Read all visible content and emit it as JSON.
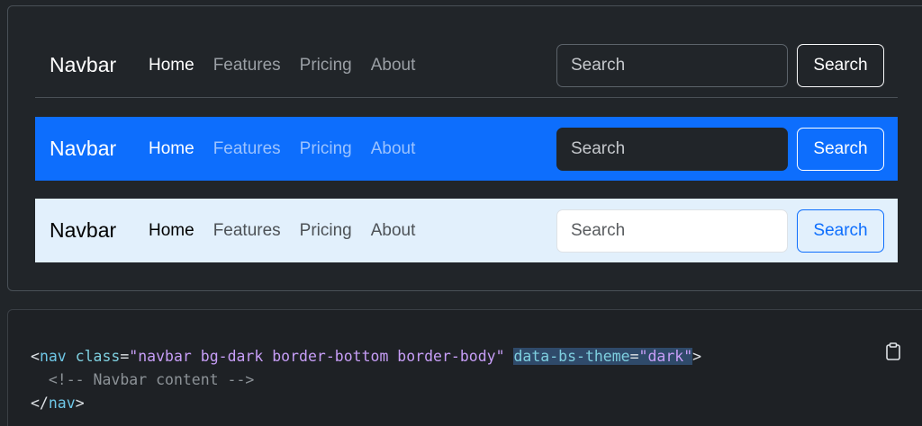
{
  "navbars": [
    {
      "brand": "Navbar",
      "links": [
        "Home",
        "Features",
        "Pricing",
        "About"
      ],
      "search_placeholder": "Search",
      "search_button": "Search"
    },
    {
      "brand": "Navbar",
      "links": [
        "Home",
        "Features",
        "Pricing",
        "About"
      ],
      "search_placeholder": "Search",
      "search_button": "Search"
    },
    {
      "brand": "Navbar",
      "links": [
        "Home",
        "Features",
        "Pricing",
        "About"
      ],
      "search_placeholder": "Search",
      "search_button": "Search"
    }
  ],
  "code": {
    "line1_open": "<",
    "line1_tag": "nav",
    "line1_attr1": "class",
    "line1_eq1": "=",
    "line1_val1": "\"navbar bg-dark border-bottom border-body\"",
    "line1_attr2": "data-bs-theme",
    "line1_eq2": "=",
    "line1_val2": "\"dark\"",
    "line1_close": ">",
    "line2_comment": "  <!-- Navbar content -->",
    "line3_open": "</",
    "line3_tag": "nav",
    "line3_close": ">"
  },
  "icons": {
    "copy": "clipboard-icon"
  },
  "colors": {
    "primary": "#0d6efd",
    "dark": "#212529",
    "light": "#e2f0fc"
  }
}
